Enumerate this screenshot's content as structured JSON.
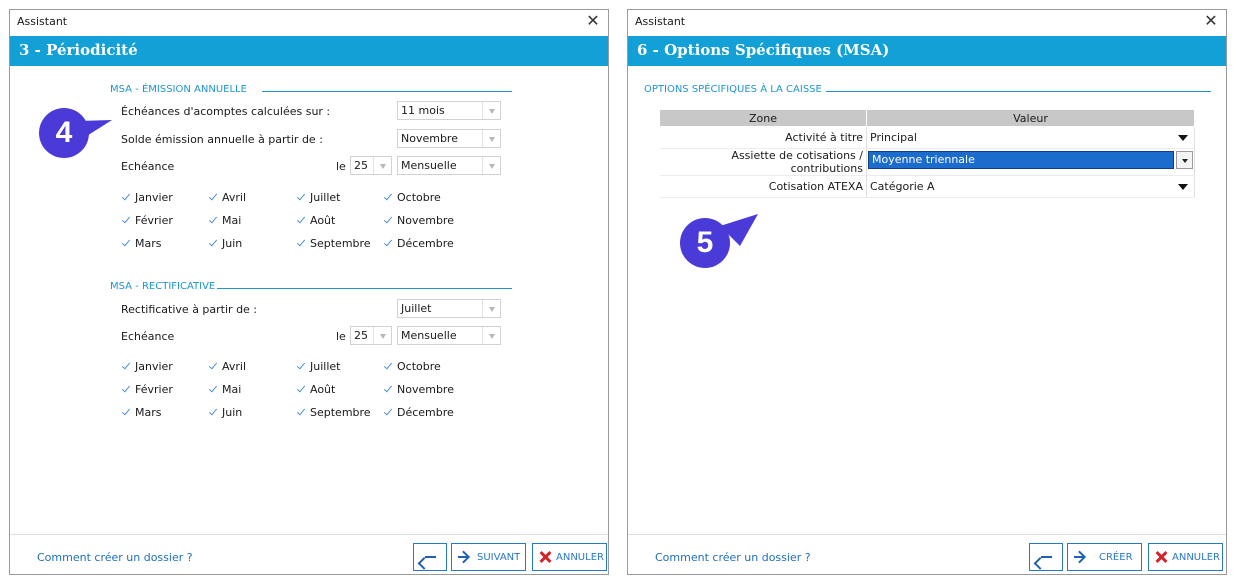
{
  "window1": {
    "title": "Assistant",
    "close": "✕",
    "banner": "3 - Périodicité",
    "section1": {
      "title": "MSA - ÉMISSION ANNUELLE",
      "row1_label": "Échéances d'acomptes calculées sur :",
      "row1_value": "11 mois",
      "row2_label": "Solde émission annuelle à partir de :",
      "row2_value": "Novembre",
      "echeance_label": "Echéance",
      "le_label": "le",
      "day_value": "25",
      "period_value": "Mensuelle",
      "months": [
        "Janvier",
        "Avril",
        "Juillet",
        "Octobre",
        "Février",
        "Mai",
        "Août",
        "Novembre",
        "Mars",
        "Juin",
        "Septembre",
        "Décembre"
      ]
    },
    "section2": {
      "title": "MSA - RECTIFICATIVE",
      "row1_label": "Rectificative à partir de :",
      "row1_value": "Juillet",
      "echeance_label": "Echéance",
      "le_label": "le",
      "day_value": "25",
      "period_value": "Mensuelle",
      "months": [
        "Janvier",
        "Avril",
        "Juillet",
        "Octobre",
        "Février",
        "Mai",
        "Août",
        "Novembre",
        "Mars",
        "Juin",
        "Septembre",
        "Décembre"
      ]
    },
    "help_link": "Comment créer un dossier ?",
    "next_label": "SUIVANT",
    "cancel_label": "ANNULER",
    "callout": "4"
  },
  "window2": {
    "title": "Assistant",
    "close": "✕",
    "banner": "6 - Options Spécifiques (MSA)",
    "section_title": "OPTIONS SPÉCIFIQUES À LA CAISSE",
    "table": {
      "headers": [
        "Zone",
        "Valeur"
      ],
      "rows": [
        {
          "zone": "Activité à titre",
          "value": "Principal"
        },
        {
          "zone": "Assiette de cotisations / contributions",
          "value": "Moyenne triennale"
        },
        {
          "zone": "Cotisation ATEXA",
          "value": "Catégorie A"
        }
      ]
    },
    "help_link": "Comment créer un dossier ?",
    "create_label": "CRÉER",
    "cancel_label": "ANNULER",
    "callout": "5"
  },
  "colors": {
    "accent": "#12a0d6",
    "callout": "#4a3bd8",
    "link": "#1f6fb8",
    "cancel_x": "#d0262c"
  }
}
